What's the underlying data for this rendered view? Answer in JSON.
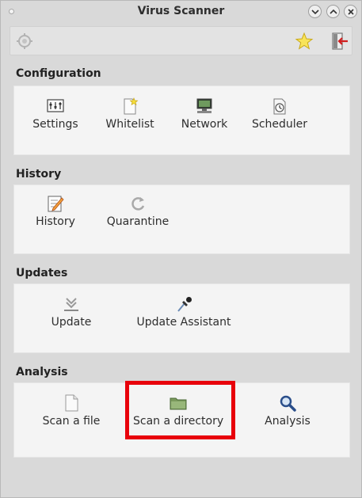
{
  "window": {
    "title": "Virus Scanner"
  },
  "toolbar": {
    "icons": [
      "scan-icon",
      "star-icon",
      "exit-icon"
    ]
  },
  "sections": [
    {
      "title": "Configuration",
      "items": [
        {
          "label": "Settings",
          "icon": "settings-icon"
        },
        {
          "label": "Whitelist",
          "icon": "whitelist-icon"
        },
        {
          "label": "Network",
          "icon": "network-icon"
        },
        {
          "label": "Scheduler",
          "icon": "scheduler-icon"
        }
      ]
    },
    {
      "title": "History",
      "items": [
        {
          "label": "History",
          "icon": "history-icon"
        },
        {
          "label": "Quarantine",
          "icon": "quarantine-icon"
        }
      ]
    },
    {
      "title": "Updates",
      "items": [
        {
          "label": "Update",
          "icon": "update-icon"
        },
        {
          "label": "Update Assistant",
          "icon": "update-assistant-icon"
        }
      ]
    },
    {
      "title": "Analysis",
      "items": [
        {
          "label": "Scan a file",
          "icon": "file-icon"
        },
        {
          "label": "Scan a directory",
          "icon": "folder-icon"
        },
        {
          "label": "Analysis",
          "icon": "magnifier-icon"
        }
      ]
    }
  ],
  "highlight": {
    "color": "#e8000b",
    "target": "Scan a directory"
  }
}
